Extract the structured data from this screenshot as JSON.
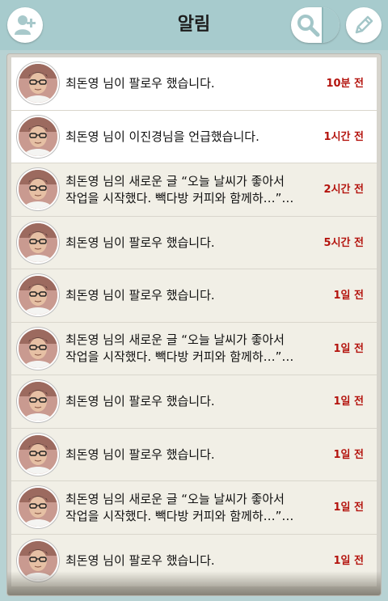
{
  "header": {
    "title": "알림"
  },
  "icons": {
    "add_friend": "add-user-icon",
    "search": "search-icon",
    "edit": "pencil-icon",
    "avatar": "profile-photo"
  },
  "colors": {
    "header_bg": "#a7cbcd",
    "time_text": "#b4140e",
    "unread_row": "#ffffff",
    "read_row": "#f1efe6"
  },
  "notifications": [
    {
      "text": "최돈영  님이 팔로우 했습니다.",
      "time": "10분 전",
      "unread": true
    },
    {
      "text": "최돈영  님이 이진경님을 언급했습니다.",
      "time": "1시간 전",
      "unread": true
    },
    {
      "text": "최돈영  님의 새로운 글 “오늘 날씨가 좋아서\n작업을 시작했다. 빽다방 커피와 함께하…”…",
      "time": "2시간 전",
      "unread": false
    },
    {
      "text": "최돈영  님이 팔로우 했습니다.",
      "time": "5시간 전",
      "unread": false
    },
    {
      "text": "최돈영  님이 팔로우 했습니다.",
      "time": "1일 전",
      "unread": false
    },
    {
      "text": "최돈영  님의 새로운 글 “오늘 날씨가 좋아서\n작업을 시작했다. 빽다방 커피와 함께하…”…",
      "time": "1일 전",
      "unread": false
    },
    {
      "text": "최돈영  님이 팔로우 했습니다.",
      "time": "1일 전",
      "unread": false
    },
    {
      "text": "최돈영  님이 팔로우 했습니다.",
      "time": "1일 전",
      "unread": false
    },
    {
      "text": "최돈영  님의 새로운 글 “오늘 날씨가 좋아서\n작업을 시작했다. 빽다방 커피와 함께하…”…",
      "time": "1일 전",
      "unread": false
    },
    {
      "text": "최돈영  님이 팔로우 했습니다.",
      "time": "1일 전",
      "unread": false
    }
  ]
}
